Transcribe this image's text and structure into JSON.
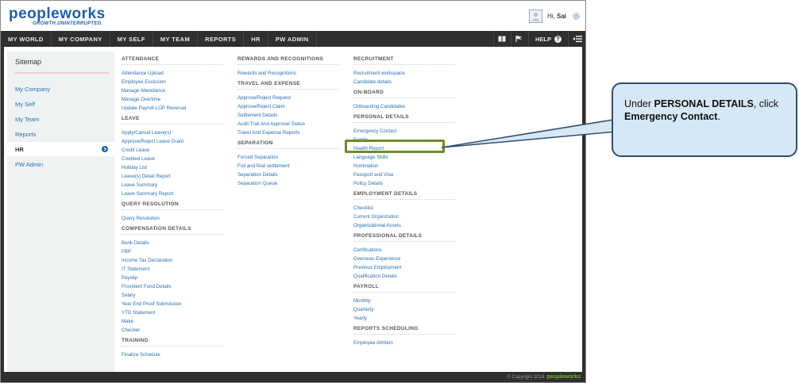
{
  "header": {
    "logo_main": "peopleworks",
    "logo_tagline": "GROWTH.UNINTERRUPTED.",
    "greeting_prefix": "Hi,",
    "user_name": "Sai"
  },
  "nav": {
    "items": [
      "MY WORLD",
      "MY COMPANY",
      "MY SELF",
      "MY TEAM",
      "REPORTS",
      "HR",
      "PW ADMIN"
    ],
    "help_label": "HELP"
  },
  "sidebar": {
    "title": "Sitemap",
    "items": [
      "My Company",
      "My Self",
      "My Team",
      "Reports",
      "HR",
      "PW Admin"
    ],
    "active": "HR"
  },
  "columns": {
    "col1": [
      {
        "heading": "ATTENDANCE",
        "links": [
          "Attendance Upload",
          "Employee Exclusion",
          "Manage Attendance",
          "Manage Overtime",
          "Update Payroll-LOP Reversal"
        ]
      },
      {
        "heading": "LEAVE",
        "links": [
          "Apply/Cancel Leave(s)",
          "Approve/Reject Leave Grant",
          "Credit Leave",
          "Credited Leave",
          "Holiday List",
          "Leave(s) Detail Report",
          "Leave Summary",
          "Leave Summary Report"
        ]
      },
      {
        "heading": "QUERY RESOLUTION",
        "links": [
          "Query Resolution"
        ]
      },
      {
        "heading": "COMPENSATION DETAILS",
        "links": [
          "Bank Details",
          "FBP",
          "Income Tax Declaration",
          "IT Statement",
          "Payslip",
          "Provident Fund Details",
          "Salary",
          "Year End Proof Submission",
          "YTD Statement",
          "Make",
          "Checker"
        ]
      },
      {
        "heading": "TRAINING",
        "links": [
          "Finalize Schedule"
        ]
      }
    ],
    "col2": [
      {
        "heading": "REWARDS AND RECOGNITIONS",
        "links": [
          "Rewards and Recognitions"
        ]
      },
      {
        "heading": "TRAVEL AND EXPENSE",
        "links": [
          "Approve/Reject Request",
          "Approve/Reject Claim",
          "Settlement Details",
          "Audit Trail And Approval Status",
          "Travel And Expense Reports"
        ]
      },
      {
        "heading": "SEPARATION",
        "links": [
          "Forced Separation",
          "Full and final settlement",
          "Separation Details",
          "Separation Queue"
        ]
      }
    ],
    "col3": [
      {
        "heading": "RECRUITMENT",
        "links": [
          "Recruitment workspace",
          "Candidate details"
        ]
      },
      {
        "heading": "ON-BOARD",
        "links": [
          "Onboarding Candidates"
        ]
      },
      {
        "heading": "PERSONAL DETAILS",
        "links": [
          "Emergency Contact",
          "Family",
          "Health Report",
          "Language Skills",
          "Nomination",
          "Passport and Visa",
          "Policy Details"
        ]
      },
      {
        "heading": "EMPLOYMENT DETAILS",
        "links": [
          "Checklist",
          "Current Organization",
          "Organizational Assets"
        ]
      },
      {
        "heading": "PROFESSIONAL DETAILS",
        "links": [
          "Certifications",
          "Overseas Experience",
          "Previous Employment",
          "Qualification Details"
        ]
      },
      {
        "heading": "PAYROLL",
        "links": [
          "Monthly",
          "Quarterly",
          "Yearly"
        ]
      },
      {
        "heading": "REPORTS SCHEDULING",
        "links": [
          "Employee Attrition"
        ]
      }
    ]
  },
  "footer": {
    "copyright": "© Copyright 2014",
    "brand": "peopleworks"
  },
  "callout": {
    "prefix": "Under ",
    "bold1": "PERSONAL DETAILS",
    "middle": ", click ",
    "bold2": "Emergency Contact",
    "suffix": "."
  },
  "colors": {
    "brand_blue": "#1f5ea8",
    "brand_green": "#6fb23a",
    "nav_bg": "#2f2f2f",
    "link": "#2a6fb0",
    "highlight": "#6d8a2a",
    "callout_bg": "#d6e8f6"
  }
}
